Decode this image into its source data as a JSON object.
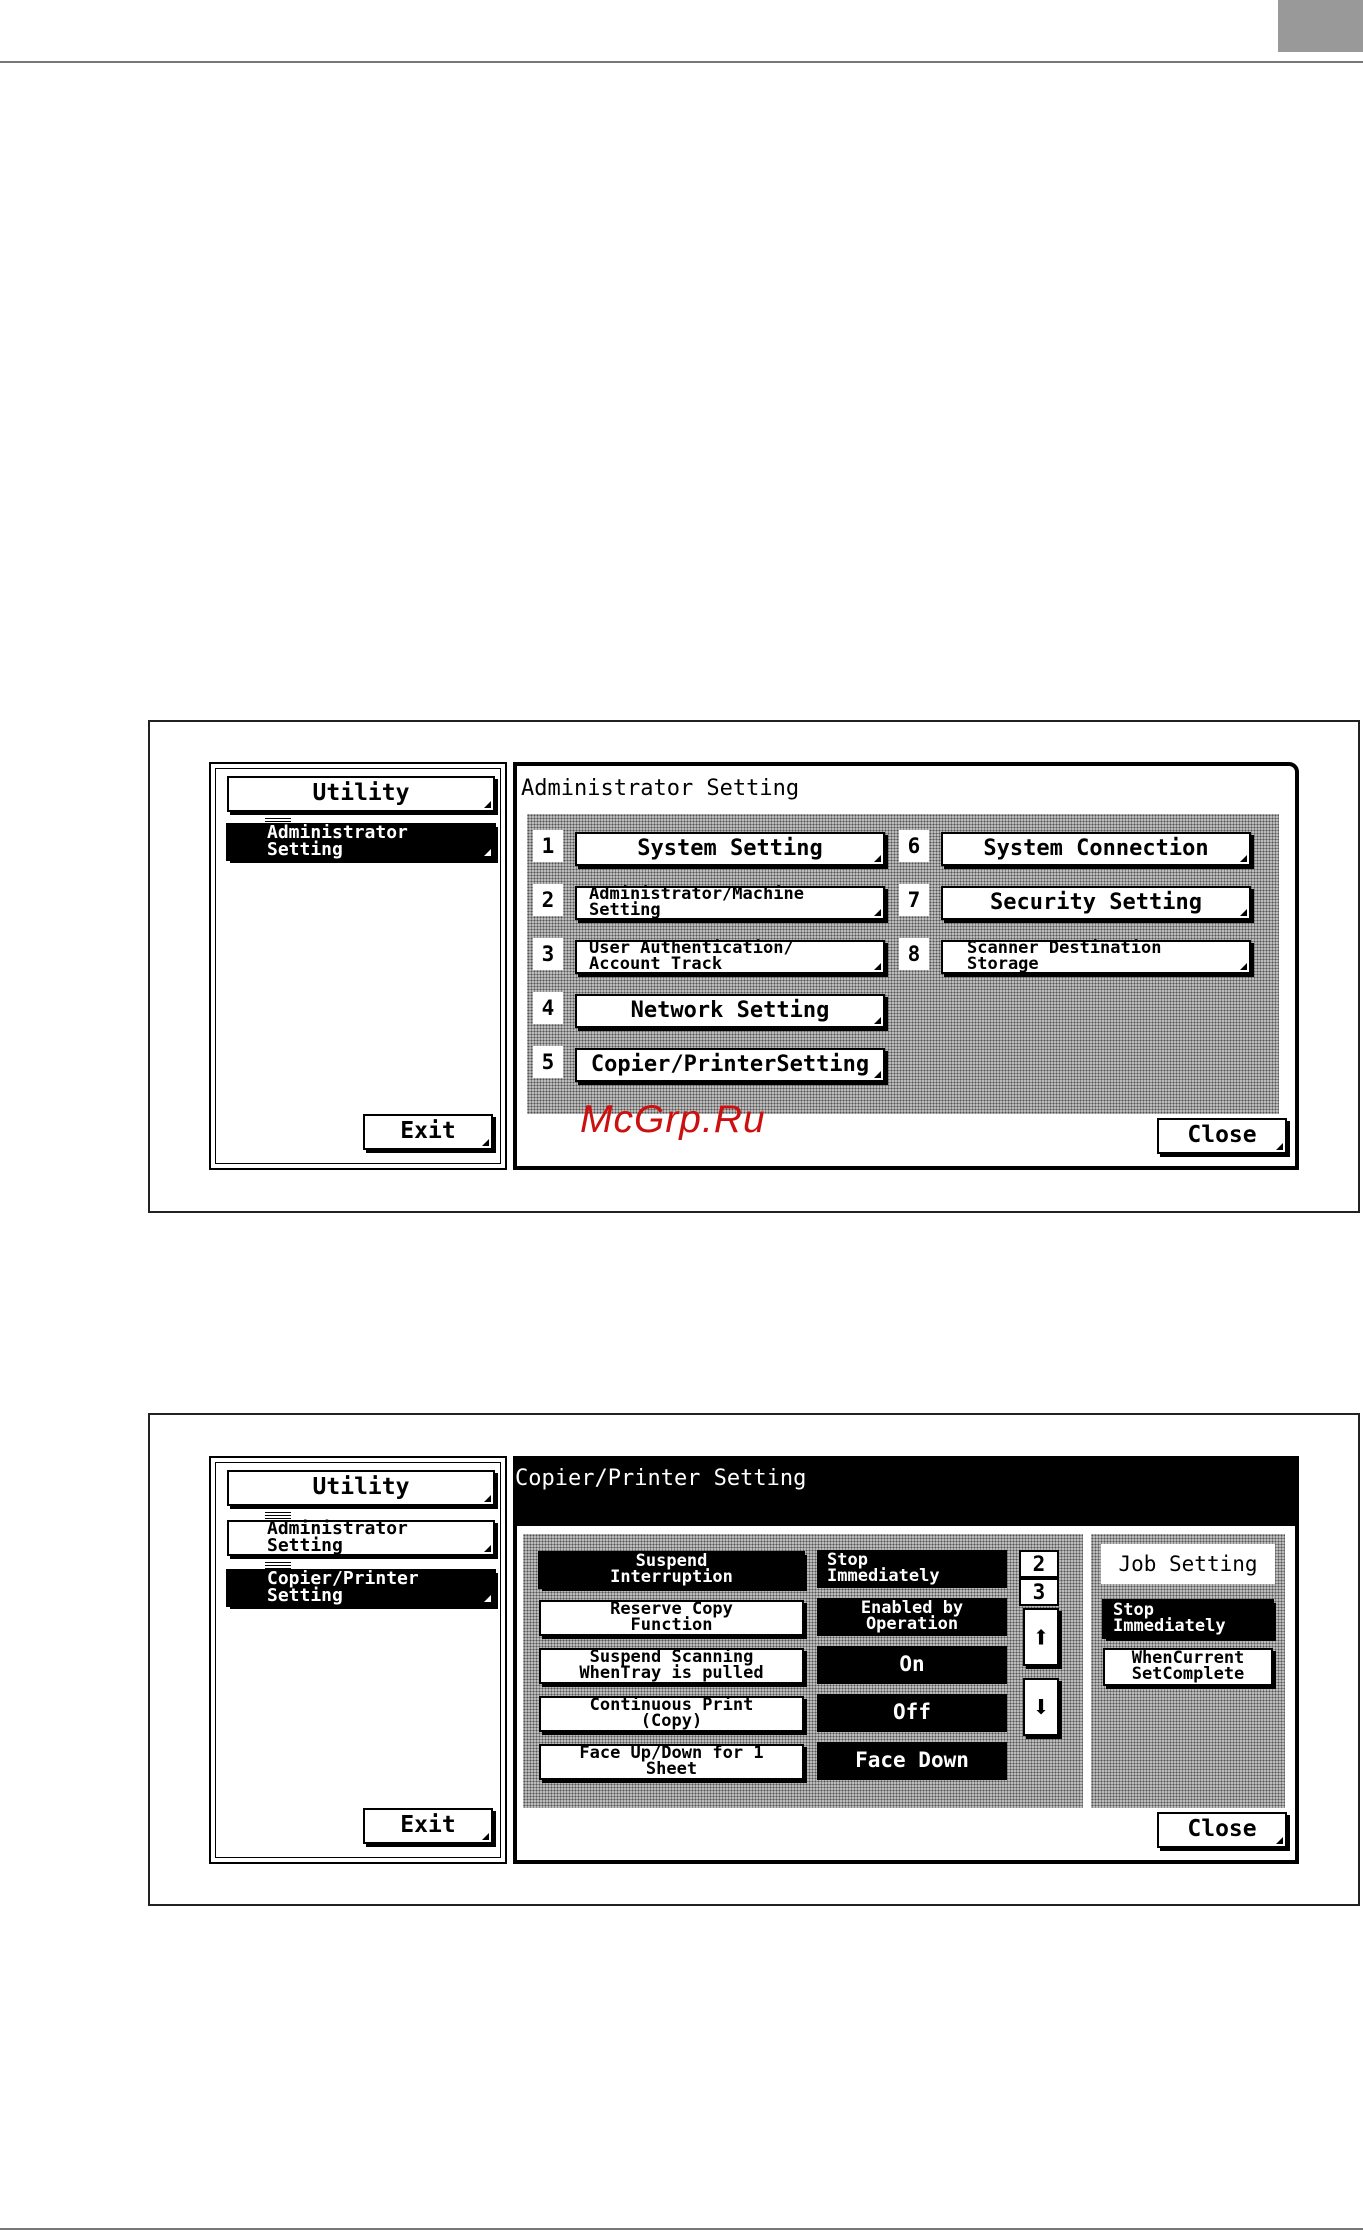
{
  "watermark": "McGrp.Ru",
  "screen1": {
    "left": {
      "utility": "Utility",
      "admin": "Administrator Setting",
      "exit": "Exit"
    },
    "title": "Administrator Setting",
    "items": [
      {
        "num": "1",
        "label": "System Setting"
      },
      {
        "num": "2",
        "label": "Administrator/Machine Setting"
      },
      {
        "num": "3",
        "label": "User Authentication/ Account Track"
      },
      {
        "num": "4",
        "label": "Network Setting"
      },
      {
        "num": "5",
        "label": "Copier/PrinterSetting"
      },
      {
        "num": "6",
        "label": "System Connection"
      },
      {
        "num": "7",
        "label": "Security Setting"
      },
      {
        "num": "8",
        "label": "Scanner Destination Storage"
      }
    ],
    "close": "Close"
  },
  "screen2": {
    "left": {
      "utility": "Utility",
      "admin": "Administrator Setting",
      "copier": "Copier/Printer Setting",
      "exit": "Exit"
    },
    "title": "Copier/Printer Setting",
    "rows": [
      {
        "label": "Suspend Interruption",
        "value": "Stop Immediately"
      },
      {
        "label": "Reserve Copy Function",
        "value": "Enabled by Operation"
      },
      {
        "label": "Suspend Scanning WhenTray is pulled",
        "value": "On"
      },
      {
        "label": "Continuous Print (Copy)",
        "value": "Off"
      },
      {
        "label": "Face Up/Down for 1 Sheet",
        "value": "Face Down"
      }
    ],
    "page_current": "2",
    "page_total": "3",
    "job_setting": "Job Setting",
    "stop_immediately": "Stop Immediately",
    "when_current": "WhenCurrent SetComplete",
    "close": "Close"
  }
}
